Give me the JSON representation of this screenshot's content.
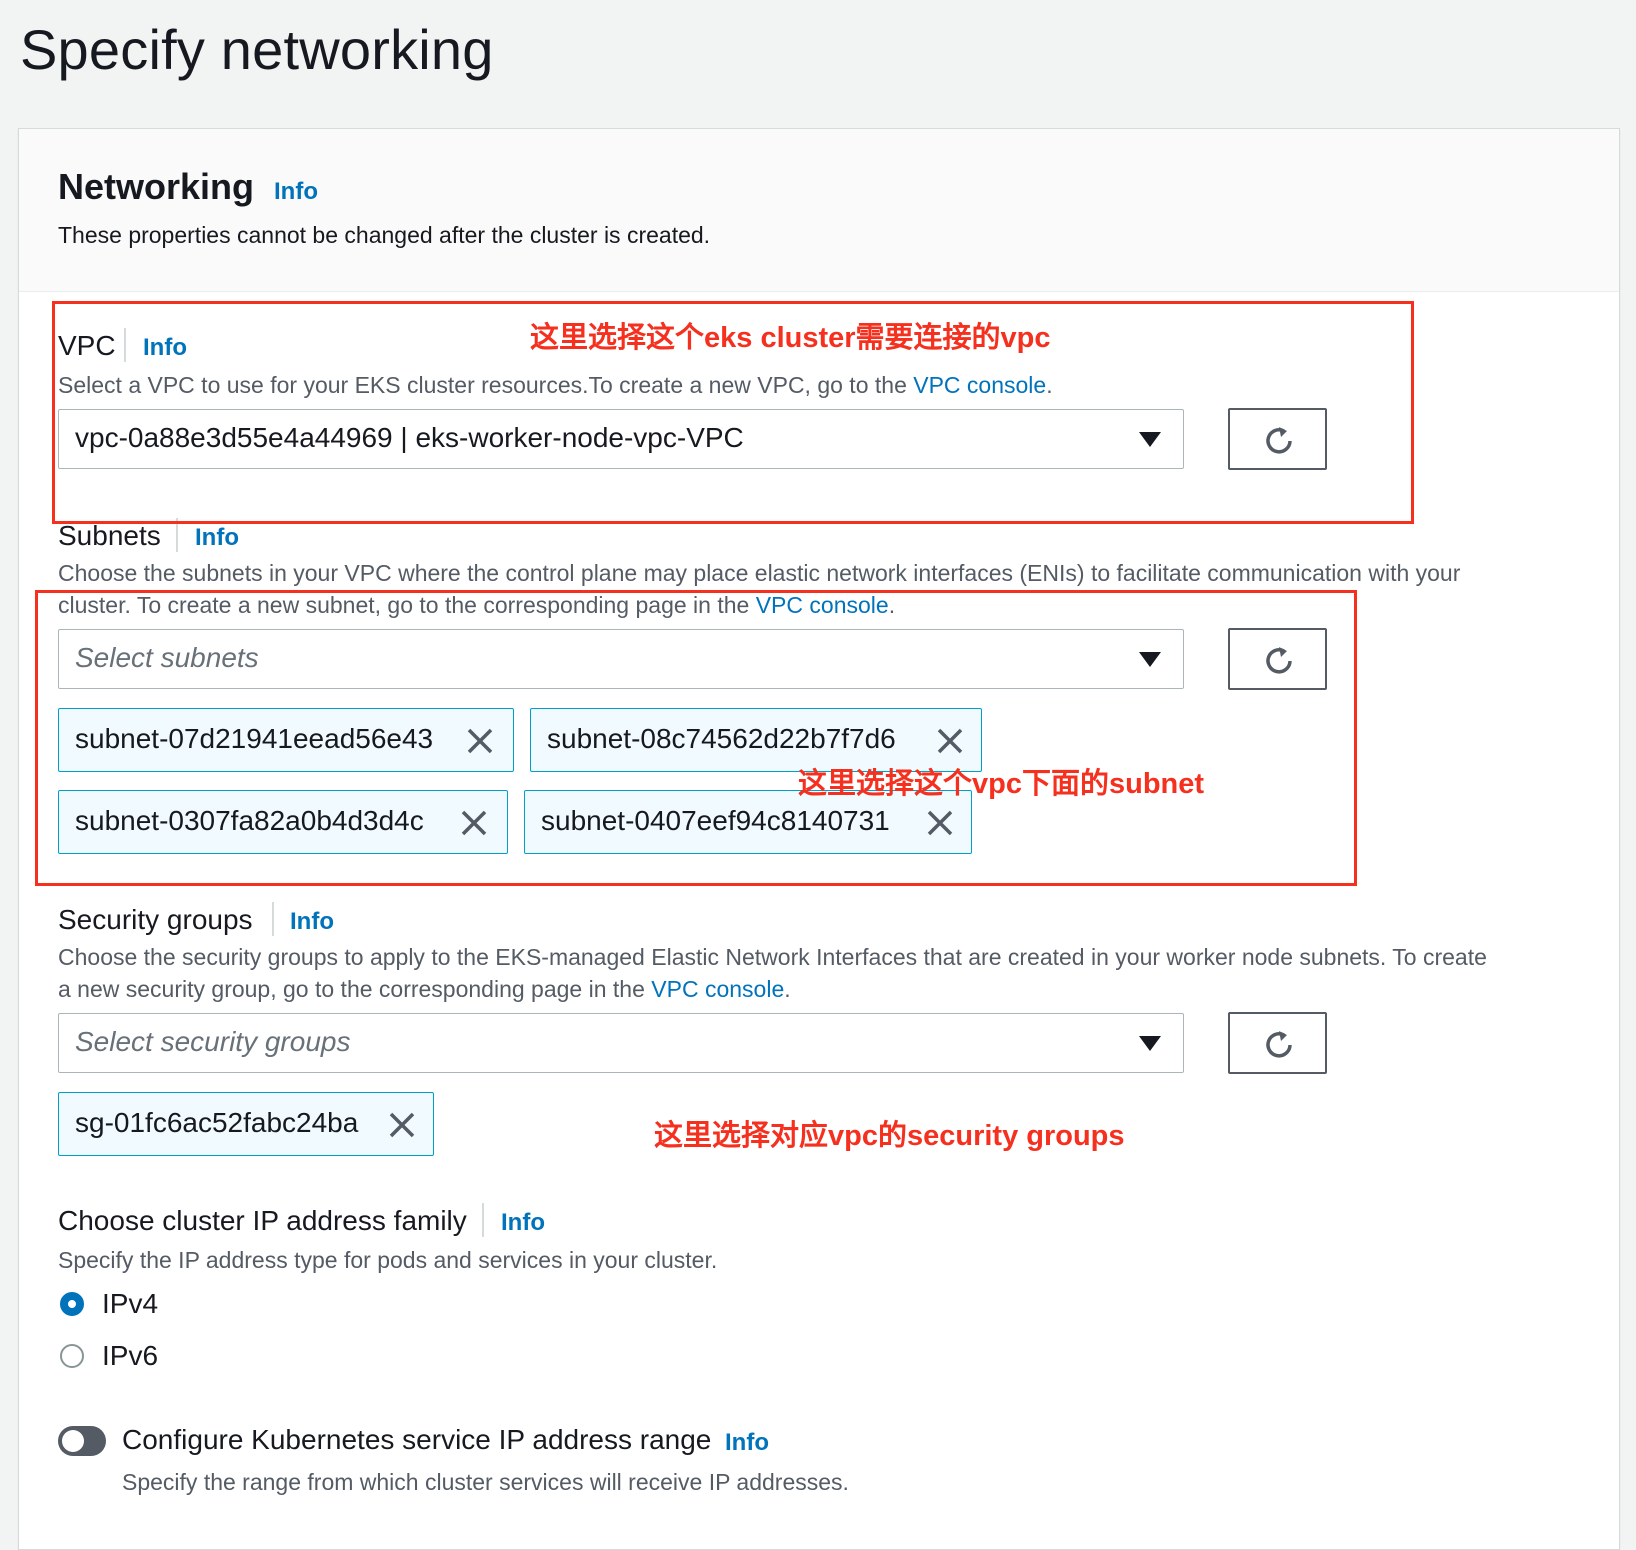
{
  "page_title": "Specify networking",
  "panel": {
    "title": "Networking",
    "info": "Info",
    "description": "These properties cannot be changed after the cluster is created."
  },
  "vpc": {
    "label": "VPC",
    "info": "Info",
    "desc_prefix": "Select a VPC to use for your EKS cluster resources.To create a new VPC, go to the",
    "desc_link": "VPC console",
    "desc_suffix": ".",
    "selected": "vpc-0a88e3d55e4a44969 | eks-worker-node-vpc-VPC"
  },
  "subnets": {
    "label": "Subnets",
    "info": "Info",
    "desc_line1": "Choose the subnets in your VPC where the control plane may place elastic network interfaces (ENIs) to facilitate communication with your",
    "desc_line2_prefix": "cluster. To create a new subnet, go to the corresponding page in the",
    "desc_link": "VPC console",
    "desc_suffix": ".",
    "placeholder": "Select subnets",
    "tokens": [
      "subnet-07d21941eead56e43",
      "subnet-08c74562d22b7f7d6",
      "subnet-0307fa82a0b4d3d4c",
      "subnet-0407eef94c8140731"
    ]
  },
  "security_groups": {
    "label": "Security groups",
    "info": "Info",
    "desc_line1": "Choose the security groups to apply to the EKS-managed Elastic Network Interfaces that are created in your worker node subnets. To create",
    "desc_line2_prefix": "a new security group, go to the corresponding page in the",
    "desc_link": "VPC console",
    "desc_suffix": ".",
    "placeholder": "Select security groups",
    "tokens": [
      "sg-01fc6ac52fabc24ba"
    ]
  },
  "ip_family": {
    "label": "Choose cluster IP address family",
    "info": "Info",
    "description": "Specify the IP address type for pods and services in your cluster.",
    "options": [
      "IPv4",
      "IPv6"
    ],
    "selected": "IPv4"
  },
  "k8s_range": {
    "label": "Configure Kubernetes service IP address range",
    "info": "Info",
    "description": "Specify the range from which cluster services will receive IP addresses.",
    "enabled": false
  },
  "annotations": {
    "vpc_note": "这里选择这个eks cluster需要连接的vpc",
    "subnet_note": "这里选择这个vpc下面的subnet",
    "sg_note": "这里选择对应vpc的security groups"
  },
  "colors": {
    "accent": "#0073bb",
    "annotation": "#f5301f",
    "token_border": "#00a1c9",
    "token_bg": "#f1faff"
  },
  "icons": {
    "refresh": "refresh-icon",
    "dismiss": "close-icon",
    "dropdown": "caret-down-icon"
  }
}
